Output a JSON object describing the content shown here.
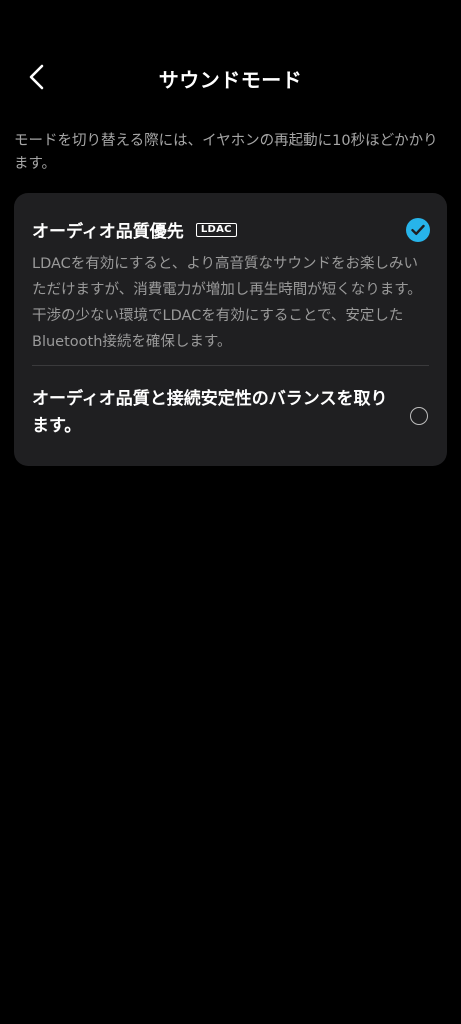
{
  "header": {
    "title": "サウンドモード",
    "back_icon": "chevron-left-icon"
  },
  "description": "モードを切り替える際には、イヤホンの再起動に10秒ほどかかります。",
  "options": [
    {
      "title": "オーディオ品質優先",
      "badge": "LDAC",
      "description": "LDACを有効にすると、より高音質なサウンドをお楽しみいただけますが、消費電力が増加し再生時間が短くなります。干渉の少ない環境でLDACを有効にすることで、安定したBluetooth接続を確保します。",
      "selected": true
    },
    {
      "title": "オーディオ品質と接続安定性のバランスを取ります。",
      "selected": false
    }
  ],
  "colors": {
    "background": "#000000",
    "card": "#1f1f21",
    "accent": "#27b4ea",
    "secondary_text": "#9a9a9a"
  }
}
